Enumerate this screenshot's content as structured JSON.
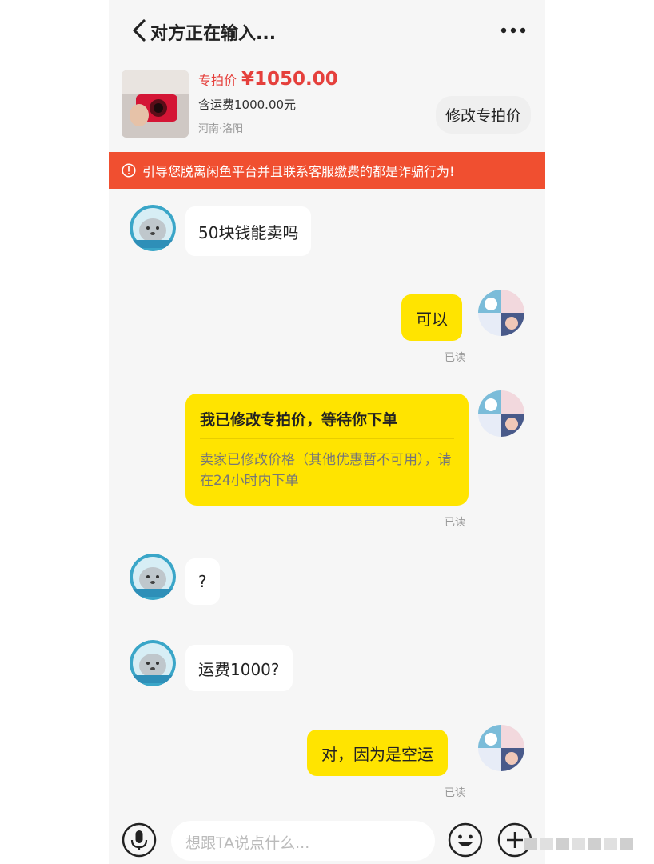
{
  "header": {
    "title": "对方正在输入..."
  },
  "product": {
    "price_tag": "专拍价",
    "price": "¥1050.00",
    "shipping": "含运费1000.00元",
    "location": "河南·洛阳",
    "edit_button": "修改专拍价"
  },
  "warning": {
    "text": "引导您脱离闲鱼平台并且联系客服缴费的都是诈骗行为!"
  },
  "messages": [
    {
      "side": "left",
      "text": "50块钱能卖吗"
    },
    {
      "side": "right",
      "text": "可以",
      "status": "已读"
    },
    {
      "side": "right",
      "card_title": "我已修改专拍价，等待你下单",
      "card_body": "卖家已修改价格（其他优惠暂不可用），请在24小时内下单",
      "status": "已读"
    },
    {
      "side": "left",
      "text": "?"
    },
    {
      "side": "left",
      "text": "运费1000?"
    },
    {
      "side": "right",
      "text": "对，因为是空运",
      "status": "已读"
    }
  ],
  "input": {
    "placeholder": "想跟TA说点什么..."
  },
  "colors": {
    "accent_yellow": "#ffe400",
    "warning_red": "#f04f30",
    "price_red": "#e5403c"
  }
}
